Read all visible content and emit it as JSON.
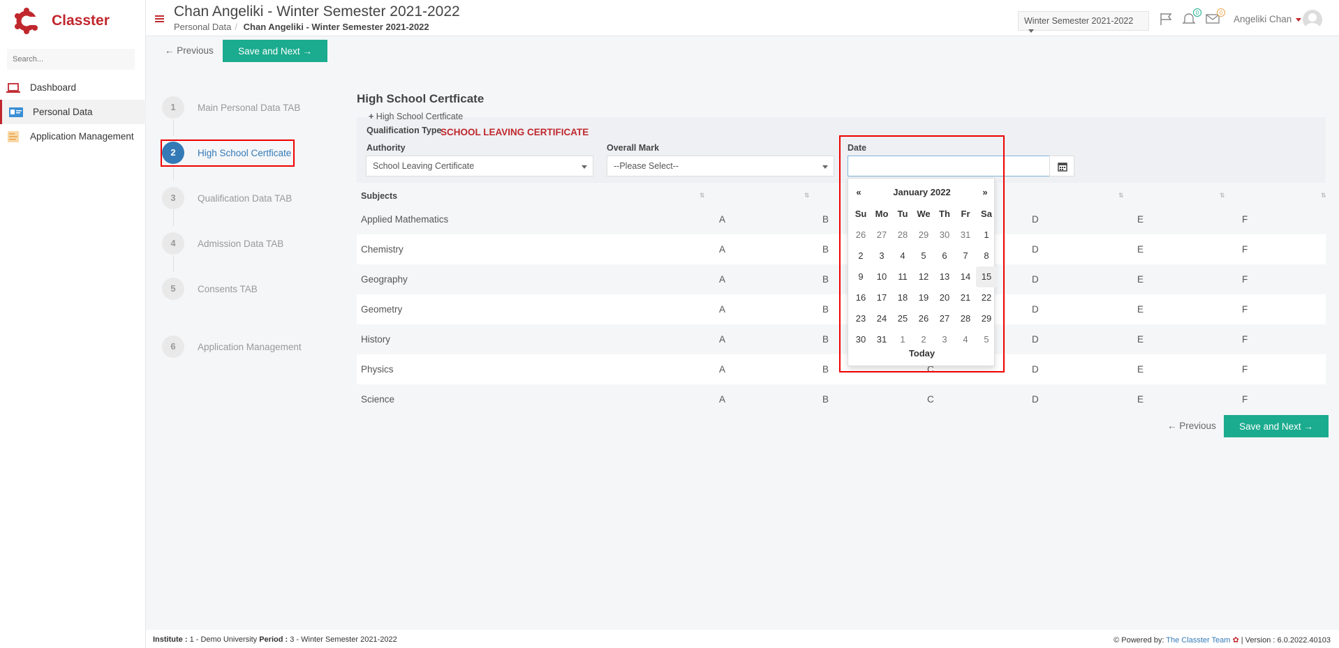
{
  "brand": {
    "name": "Classter",
    "color": "#c0272d",
    "accent": "#1bab8e",
    "active_blue": "#337ab7"
  },
  "sidebar": {
    "search_placeholder": "Search...",
    "items": [
      {
        "label": "Dashboard",
        "icon": "laptop-icon",
        "active": false
      },
      {
        "label": "Personal Data",
        "icon": "id-card-icon",
        "active": true
      },
      {
        "label": "Application Management",
        "icon": "clipboard-icon",
        "active": false
      }
    ]
  },
  "header": {
    "title": "Chan Angeliki - Winter Semester 2021-2022",
    "breadcrumb": [
      "Personal Data",
      "Chan Angeliki - Winter Semester 2021-2022"
    ],
    "semester_select": "Winter Semester 2021-2022",
    "flag_icon": "flag-icon",
    "notifications_count": "0",
    "messages_count": "0",
    "user_name": "Angeliki Chan"
  },
  "toolbar": {
    "previous_label": "Previous",
    "save_next_label": "Save and Next"
  },
  "steps": [
    {
      "num": "1",
      "label": "Main Personal Data TAB",
      "active": false
    },
    {
      "num": "2",
      "label": "High School Certficate",
      "active": true
    },
    {
      "num": "3",
      "label": "Qualification Data TAB",
      "active": false
    },
    {
      "num": "4",
      "label": "Admission Data TAB",
      "active": false
    },
    {
      "num": "5",
      "label": "Consents TAB",
      "active": false
    },
    {
      "num": "6",
      "label": "Application Management",
      "active": false
    }
  ],
  "form": {
    "section_title": "High School Certficate",
    "add_title": "High School Certficate",
    "qualification_type_label": "Qualification Type",
    "qualification_type_value": "SCHOOL LEAVING CERTIFICATE",
    "authority_label": "Authority",
    "authority_value": "School Leaving Certificate",
    "overall_mark_label": "Overall Mark",
    "overall_mark_value": "--Please Select--",
    "date_label": "Date",
    "date_value": ""
  },
  "table": {
    "header": "Subjects",
    "grades": [
      "A",
      "B",
      "C",
      "D",
      "E",
      "F"
    ],
    "subjects": [
      "Applied Mathematics",
      "Chemistry",
      "Geography",
      "Geometry",
      "History",
      "Physics",
      "Science"
    ]
  },
  "datepicker": {
    "month_label": "January 2022",
    "prev": "«",
    "next": "»",
    "weekdays": [
      "Su",
      "Mo",
      "Tu",
      "We",
      "Th",
      "Fr",
      "Sa"
    ],
    "weeks": [
      [
        "26",
        "27",
        "28",
        "29",
        "30",
        "31",
        "1"
      ],
      [
        "2",
        "3",
        "4",
        "5",
        "6",
        "7",
        "8"
      ],
      [
        "9",
        "10",
        "11",
        "12",
        "13",
        "14",
        "15"
      ],
      [
        "16",
        "17",
        "18",
        "19",
        "20",
        "21",
        "22"
      ],
      [
        "23",
        "24",
        "25",
        "26",
        "27",
        "28",
        "29"
      ],
      [
        "30",
        "31",
        "1",
        "2",
        "3",
        "4",
        "5"
      ]
    ],
    "highlighted_day": "15",
    "today_label": "Today"
  },
  "footer": {
    "institute_label": "Institute :",
    "institute_value": "1 - Demo University",
    "period_label": "Period :",
    "period_value": "3 - Winter Semester 2021-2022",
    "powered_by": "Powered by:",
    "team_link": "The Classter Team",
    "version": "| Version : 6.0.2022.40103"
  }
}
